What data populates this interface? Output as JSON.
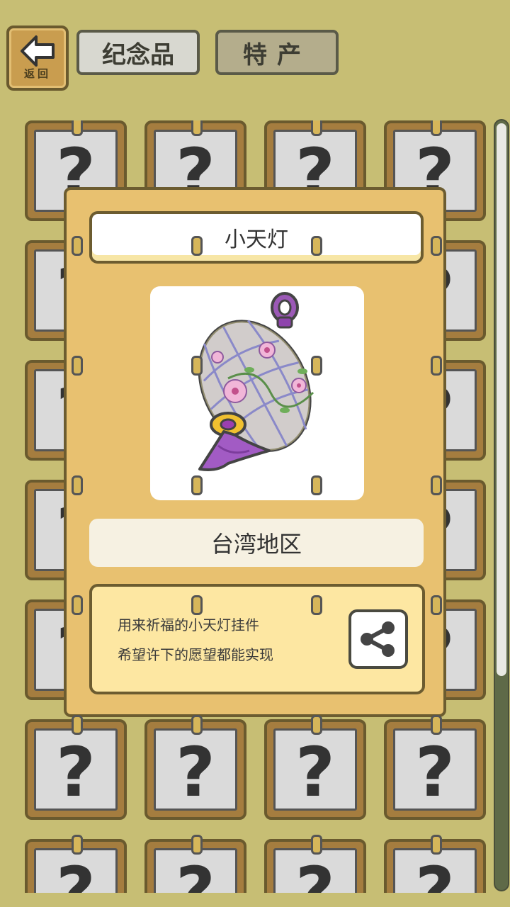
{
  "header": {
    "back_label": "返回",
    "tabs": [
      {
        "label": "纪念品",
        "active": false
      },
      {
        "label": "特产",
        "active": true
      }
    ]
  },
  "grid": {
    "unknown_symbol": "?"
  },
  "popup": {
    "item_name": "小天灯",
    "item_icon": "sky-lantern",
    "region": "台湾地区",
    "description": [
      "用来祈福的小天灯挂件",
      "希望许下的愿望都能实现"
    ],
    "share_icon": "share-icon"
  },
  "colors": {
    "background": "#c7be74",
    "popup": "#e8c170",
    "card_frame": "#a57d3f",
    "desc_box": "#fde7a2"
  }
}
